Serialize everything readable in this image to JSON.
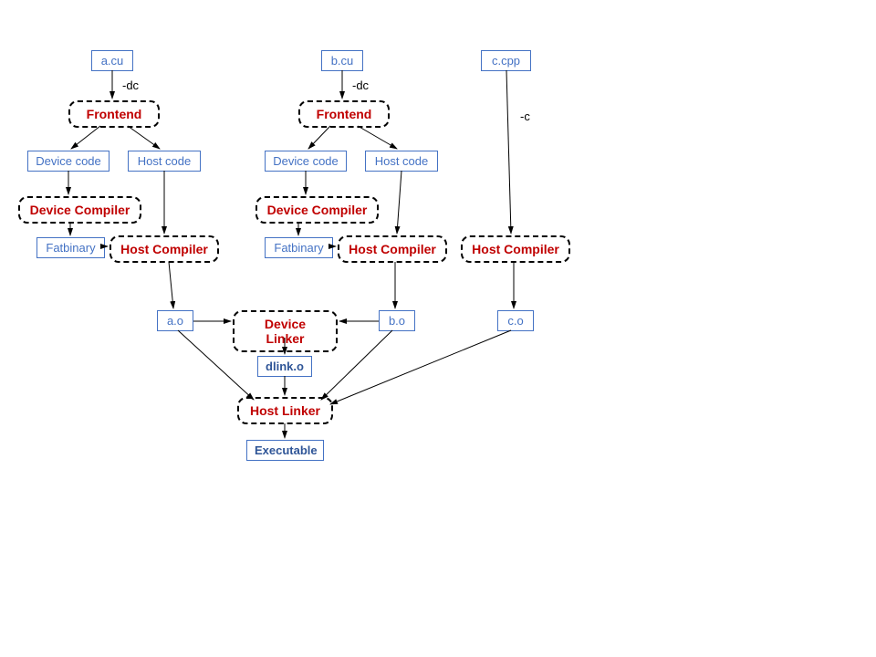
{
  "nodes": {
    "acu": "a.cu",
    "bcu": "b.cu",
    "ccpp": "c.cpp",
    "dc1": "-dc",
    "dc2": "-dc",
    "cflag": "-c",
    "frontend1": "Frontend",
    "frontend2": "Frontend",
    "devcode1": "Device code",
    "hostcode1": "Host code",
    "devcode2": "Device code",
    "hostcode2": "Host code",
    "devcomp1": "Device Compiler",
    "devcomp2": "Device Compiler",
    "fatbin1": "Fatbinary",
    "fatbin2": "Fatbinary",
    "hostcomp1": "Host Compiler",
    "hostcomp2": "Host Compiler",
    "hostcomp3": "Host Compiler",
    "ao": "a.o",
    "bo": "b.o",
    "co": "c.o",
    "devlinker": "Device Linker",
    "dlinko": "dlink.o",
    "hostlinker": "Host Linker",
    "exe": "Executable"
  }
}
